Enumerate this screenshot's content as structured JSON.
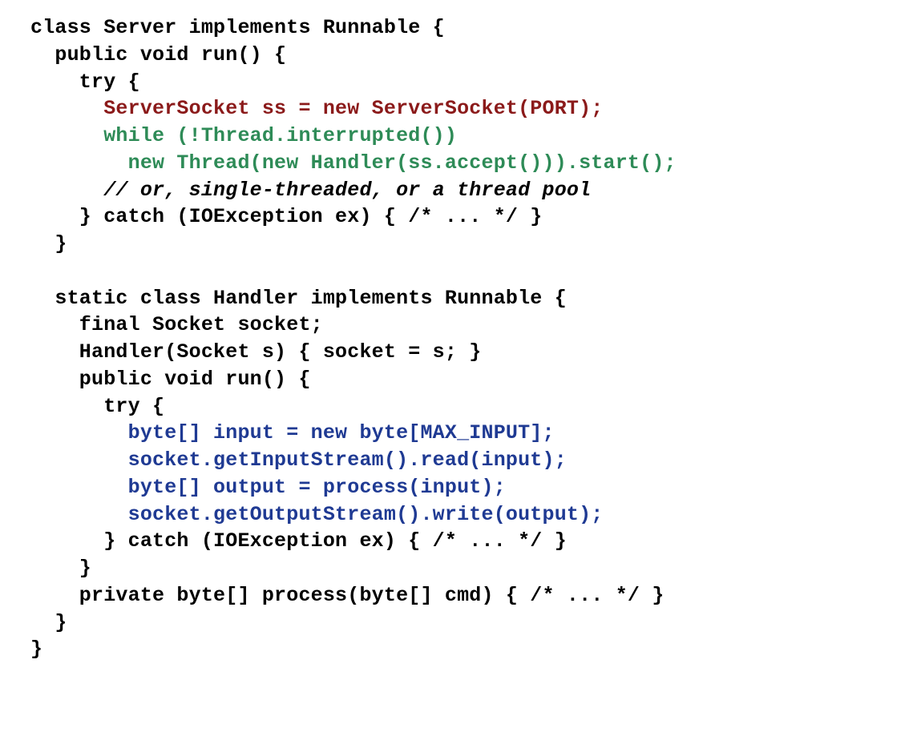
{
  "code": {
    "l01": "class Server implements Runnable {",
    "l02": "  public void run() {",
    "l03": "    try {",
    "l04": "      ServerSocket ss = new ServerSocket(PORT);",
    "l05": "      while (!Thread.interrupted())",
    "l06": "        new Thread(new Handler(ss.accept())).start();",
    "l07": "      // or, single-threaded, or a thread pool",
    "l08": "    } catch (IOException ex) { /* ... */ }",
    "l09": "  }",
    "l10": "",
    "l11": "  static class Handler implements Runnable {",
    "l12": "    final Socket socket;",
    "l13": "    Handler(Socket s) { socket = s; }",
    "l14": "    public void run() {",
    "l15": "      try {",
    "l16": "        byte[] input = new byte[MAX_INPUT];",
    "l17": "        socket.getInputStream().read(input);",
    "l18": "        byte[] output = process(input);",
    "l19": "        socket.getOutputStream().write(output);",
    "l20": "      } catch (IOException ex) { /* ... */ }",
    "l21": "    }",
    "l22": "    private byte[] process(byte[] cmd) { /* ... */ }",
    "l23": "  }",
    "l24": "}"
  },
  "colors": {
    "black": "#000000",
    "red": "#8b1a1a",
    "green": "#2e8b57",
    "blue": "#1f3a93"
  }
}
